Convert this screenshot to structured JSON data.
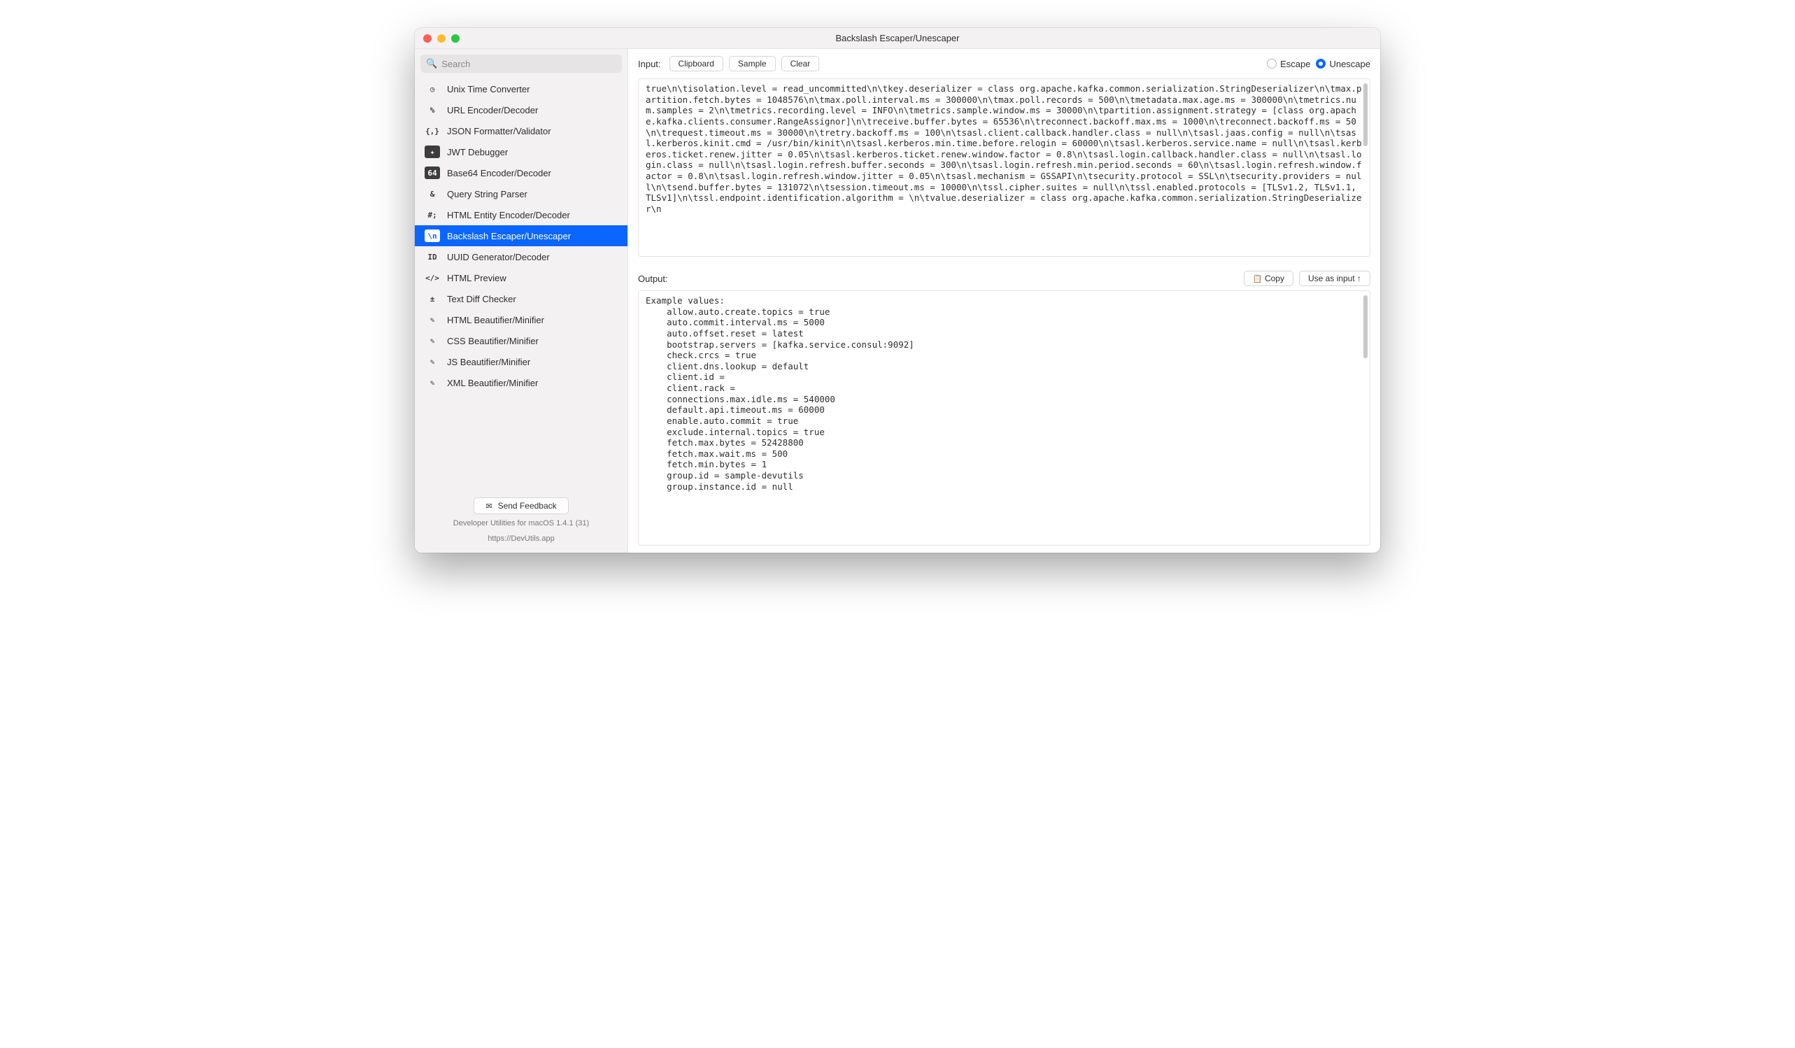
{
  "title": "Backslash Escaper/Unescaper",
  "search_placeholder": "Search",
  "sidebar": {
    "items": [
      {
        "icon": "◷",
        "label": "Unix Time Converter"
      },
      {
        "icon": "%",
        "label": "URL Encoder/Decoder"
      },
      {
        "icon": "{,}",
        "label": "JSON Formatter/Validator"
      },
      {
        "icon": "✦",
        "label": "JWT Debugger",
        "boxed": true
      },
      {
        "icon": "64",
        "label": "Base64 Encoder/Decoder",
        "boxed": true
      },
      {
        "icon": "&",
        "label": "Query String Parser"
      },
      {
        "icon": "#;",
        "label": "HTML Entity Encoder/Decoder"
      },
      {
        "icon": "\\n",
        "label": "Backslash Escaper/Unescaper",
        "boxed": true,
        "selected": true
      },
      {
        "icon": "ID",
        "label": "UUID Generator/Decoder"
      },
      {
        "icon": "</>",
        "label": "HTML Preview"
      },
      {
        "icon": "±",
        "label": "Text Diff Checker"
      },
      {
        "icon": "✎",
        "label": "HTML Beautifier/Minifier"
      },
      {
        "icon": "✎",
        "label": "CSS Beautifier/Minifier"
      },
      {
        "icon": "✎",
        "label": "JS Beautifier/Minifier"
      },
      {
        "icon": "✎",
        "label": "XML Beautifier/Minifier"
      }
    ],
    "feedback_label": "Send Feedback",
    "footer_line1": "Developer Utilities for macOS 1.4.1 (31)",
    "footer_line2": "https://DevUtils.app"
  },
  "toolbar": {
    "input_label": "Input:",
    "clipboard": "Clipboard",
    "sample": "Sample",
    "clear": "Clear",
    "radio_escape": "Escape",
    "radio_unescape": "Unescape",
    "mode": "unescape"
  },
  "input_text": "true\\n\\tisolation.level = read_uncommitted\\n\\tkey.deserializer = class org.apache.kafka.common.serialization.StringDeserializer\\n\\tmax.partition.fetch.bytes = 1048576\\n\\tmax.poll.interval.ms = 300000\\n\\tmax.poll.records = 500\\n\\tmetadata.max.age.ms = 300000\\n\\tmetrics.num.samples = 2\\n\\tmetrics.recording.level = INFO\\n\\tmetrics.sample.window.ms = 30000\\n\\tpartition.assignment.strategy = [class org.apache.kafka.clients.consumer.RangeAssignor]\\n\\treceive.buffer.bytes = 65536\\n\\treconnect.backoff.max.ms = 1000\\n\\treconnect.backoff.ms = 50\\n\\trequest.timeout.ms = 30000\\n\\tretry.backoff.ms = 100\\n\\tsasl.client.callback.handler.class = null\\n\\tsasl.jaas.config = null\\n\\tsasl.kerberos.kinit.cmd = /usr/bin/kinit\\n\\tsasl.kerberos.min.time.before.relogin = 60000\\n\\tsasl.kerberos.service.name = null\\n\\tsasl.kerberos.ticket.renew.jitter = 0.05\\n\\tsasl.kerberos.ticket.renew.window.factor = 0.8\\n\\tsasl.login.callback.handler.class = null\\n\\tsasl.login.class = null\\n\\tsasl.login.refresh.buffer.seconds = 300\\n\\tsasl.login.refresh.min.period.seconds = 60\\n\\tsasl.login.refresh.window.factor = 0.8\\n\\tsasl.login.refresh.window.jitter = 0.05\\n\\tsasl.mechanism = GSSAPI\\n\\tsecurity.protocol = SSL\\n\\tsecurity.providers = null\\n\\tsend.buffer.bytes = 131072\\n\\tsession.timeout.ms = 10000\\n\\tssl.cipher.suites = null\\n\\tssl.enabled.protocols = [TLSv1.2, TLSv1.1, TLSv1]\\n\\tssl.endpoint.identification.algorithm = \\n\\tvalue.deserializer = class org.apache.kafka.common.serialization.StringDeserializer\\n",
  "output": {
    "label": "Output:",
    "copy": "Copy",
    "use_as_input": "Use as input  ↑",
    "text": "Example values:\n    allow.auto.create.topics = true\n    auto.commit.interval.ms = 5000\n    auto.offset.reset = latest\n    bootstrap.servers = [kafka.service.consul:9092]\n    check.crcs = true\n    client.dns.lookup = default\n    client.id = \n    client.rack = \n    connections.max.idle.ms = 540000\n    default.api.timeout.ms = 60000\n    enable.auto.commit = true\n    exclude.internal.topics = true\n    fetch.max.bytes = 52428800\n    fetch.max.wait.ms = 500\n    fetch.min.bytes = 1\n    group.id = sample-devutils\n    group.instance.id = null"
  }
}
